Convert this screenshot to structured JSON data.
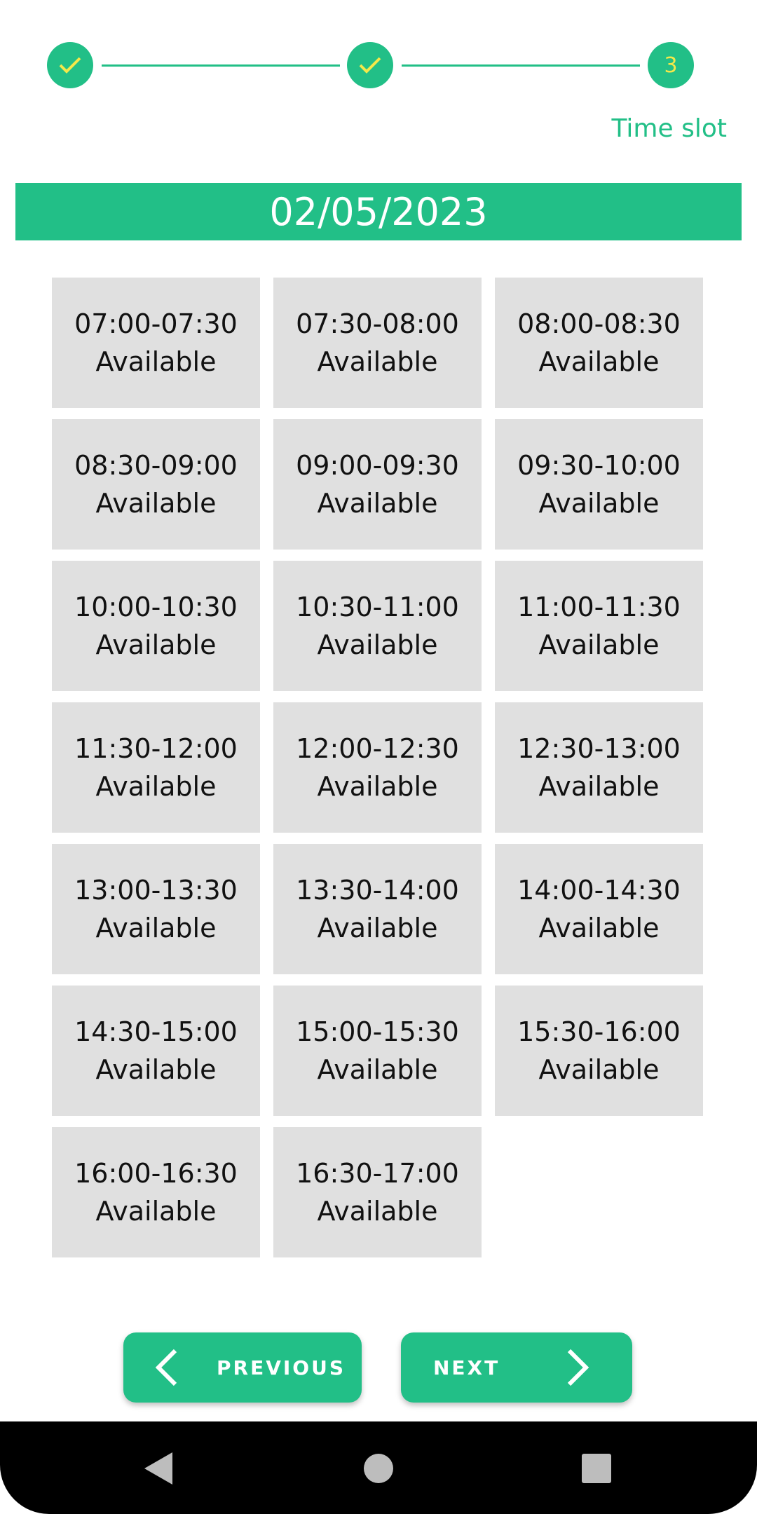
{
  "stepper": {
    "steps": [
      {
        "state": "done",
        "icon": "check-icon"
      },
      {
        "state": "done",
        "icon": "check-icon"
      },
      {
        "state": "current",
        "number": "3"
      }
    ],
    "current_label": "Time slot"
  },
  "date_banner": "02/05/2023",
  "slots": [
    {
      "time": "07:00-07:30",
      "status": "Available"
    },
    {
      "time": "07:30-08:00",
      "status": "Available"
    },
    {
      "time": "08:00-08:30",
      "status": "Available"
    },
    {
      "time": "08:30-09:00",
      "status": "Available"
    },
    {
      "time": "09:00-09:30",
      "status": "Available"
    },
    {
      "time": "09:30-10:00",
      "status": "Available"
    },
    {
      "time": "10:00-10:30",
      "status": "Available"
    },
    {
      "time": "10:30-11:00",
      "status": "Available"
    },
    {
      "time": "11:00-11:30",
      "status": "Available"
    },
    {
      "time": "11:30-12:00",
      "status": "Available"
    },
    {
      "time": "12:00-12:30",
      "status": "Available"
    },
    {
      "time": "12:30-13:00",
      "status": "Available"
    },
    {
      "time": "13:00-13:30",
      "status": "Available"
    },
    {
      "time": "13:30-14:00",
      "status": "Available"
    },
    {
      "time": "14:00-14:30",
      "status": "Available"
    },
    {
      "time": "14:30-15:00",
      "status": "Available"
    },
    {
      "time": "15:00-15:30",
      "status": "Available"
    },
    {
      "time": "15:30-16:00",
      "status": "Available"
    },
    {
      "time": "16:00-16:30",
      "status": "Available"
    },
    {
      "time": "16:30-17:00",
      "status": "Available"
    }
  ],
  "buttons": {
    "previous": "PREVIOUS",
    "next": "NEXT"
  },
  "navbar": {
    "icons": [
      "back-icon",
      "home-icon",
      "recents-icon"
    ]
  },
  "colors": {
    "accent": "#22BF87",
    "step_number": "#F3E84A",
    "slot_bg": "#E0E0E0"
  }
}
